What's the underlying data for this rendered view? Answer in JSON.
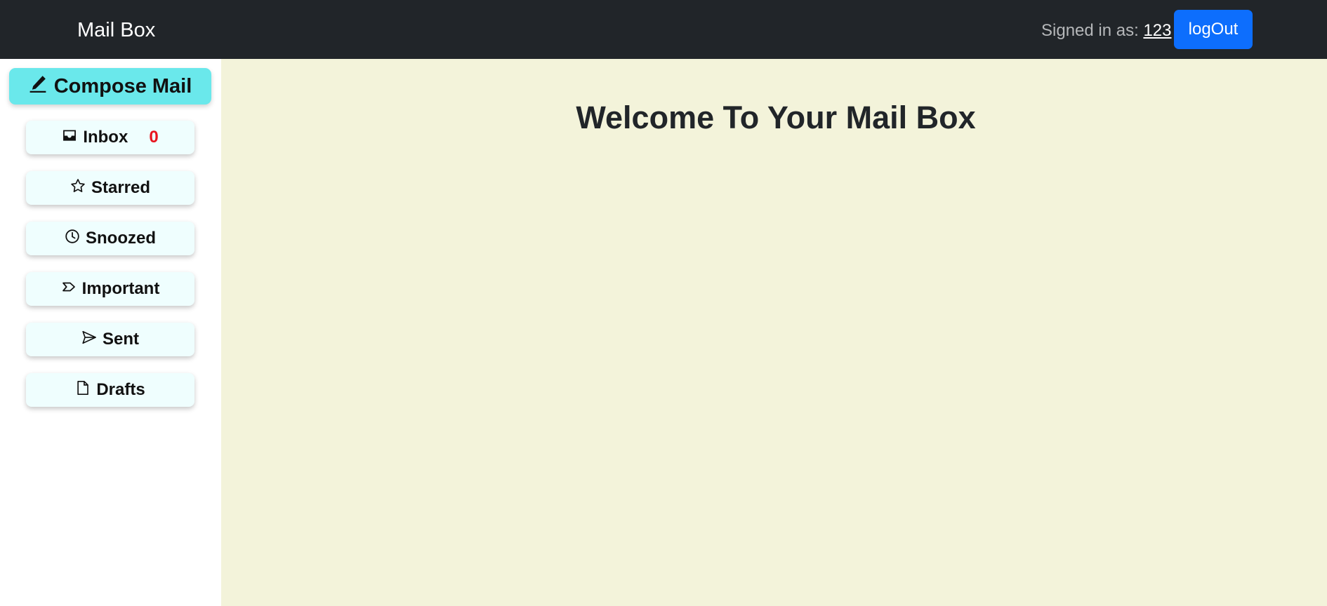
{
  "header": {
    "brand": "Mail Box",
    "signed_in_label": "Signed in as:",
    "username": "123",
    "logout_label": "logOut"
  },
  "sidebar": {
    "compose_label": "Compose Mail",
    "compose_icon": "pencil-icon",
    "items": [
      {
        "label": "Inbox",
        "icon": "inbox-icon",
        "count": "0"
      },
      {
        "label": "Starred",
        "icon": "star-icon"
      },
      {
        "label": "Snoozed",
        "icon": "clock-icon"
      },
      {
        "label": "Important",
        "icon": "important-icon"
      },
      {
        "label": "Sent",
        "icon": "send-icon"
      },
      {
        "label": "Drafts",
        "icon": "file-icon"
      }
    ]
  },
  "main": {
    "welcome": "Welcome To Your Mail Box"
  },
  "colors": {
    "navbar": "#212529",
    "logout_button": "#0d6efd",
    "compose_button": "#6ae8eb",
    "sidebar_button": "#effefe",
    "main_background": "#f3f3da",
    "badge": "#e8141e"
  }
}
